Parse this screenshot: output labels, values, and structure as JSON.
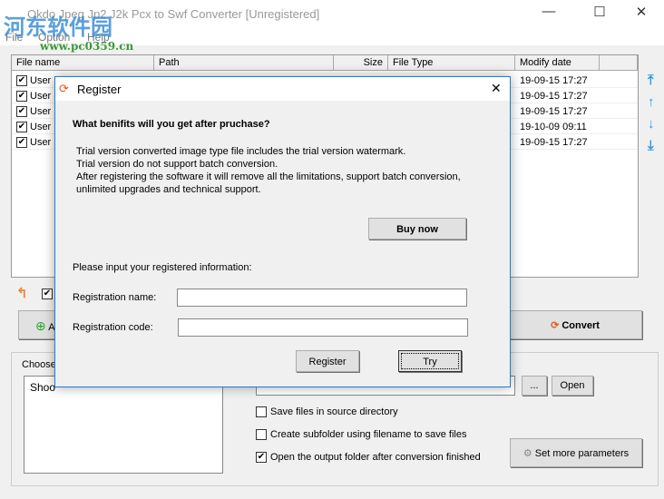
{
  "window": {
    "title": "Okdo Jpeg Jp2 J2k Pcx to Swf Converter [Unregistered]",
    "minimize": "—",
    "maximize": "☐",
    "close": "✕"
  },
  "watermark": {
    "text": "河东软件园",
    "url": "www.pc0359.cn"
  },
  "menu": [
    "File",
    "Option",
    "Help"
  ],
  "table": {
    "headers": [
      "File name",
      "Path",
      "Size",
      "File Type",
      "Modify date"
    ],
    "rows": [
      {
        "name": "User",
        "date": "19-09-15 17:27"
      },
      {
        "name": "User",
        "date": "19-09-15 17:27"
      },
      {
        "name": "User",
        "date": "19-09-15 17:27"
      },
      {
        "name": "User",
        "date": "19-10-09 09:11"
      },
      {
        "name": "User",
        "date": "19-09-15 17:27"
      }
    ]
  },
  "convert_label": "Convert",
  "add_label": "A",
  "choose_label": "Choose",
  "list_first": "Shoo",
  "options": {
    "browse": "...",
    "open": "Open",
    "save_source": "Save files in source directory",
    "subfolder": "Create subfolder using filename to save files",
    "open_output": "Open the output folder after conversion finished",
    "more": "Set more parameters"
  },
  "dialog": {
    "title": "Register",
    "close": "✕",
    "heading": "What benifits will you get after pruchase?",
    "lines": [
      "Trial version converted image type file includes the trial version watermark.",
      "Trial version do not support batch conversion.",
      "After registering the software it will remove all the limitations, support batch conversion,",
      "unlimited upgrades and technical support."
    ],
    "buy": "Buy now",
    "prompt": "Please input your registered information:",
    "name_label": "Registration name:",
    "code_label": "Registration code:",
    "name_value": "",
    "code_value": "",
    "register": "Register",
    "try": "Try"
  }
}
